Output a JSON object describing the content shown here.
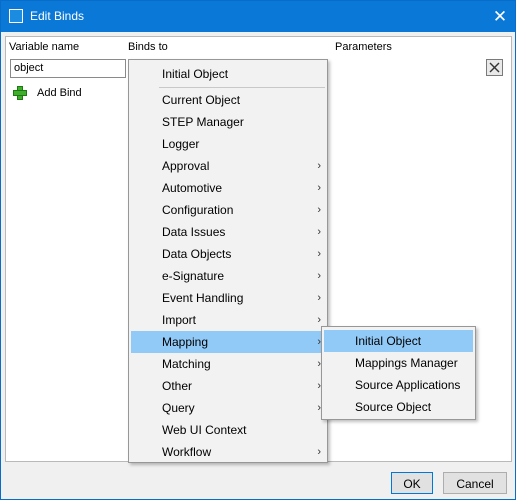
{
  "window": {
    "title": "Edit Binds",
    "close_glyph": "✕",
    "app_icon": "window-icon"
  },
  "columns": {
    "variable": "Variable name",
    "binds": "Binds to",
    "parameters": "Parameters"
  },
  "variable_input": {
    "value": "object"
  },
  "add_bind": {
    "label": "Add Bind",
    "icon": "plus-icon"
  },
  "delete_button": {
    "icon": "x-icon"
  },
  "context_menu": {
    "header": "Initial Object",
    "items": [
      {
        "label": "Current Object",
        "submenu": false
      },
      {
        "label": "STEP Manager",
        "submenu": false
      },
      {
        "label": "Logger",
        "submenu": false
      },
      {
        "label": "Approval",
        "submenu": true
      },
      {
        "label": "Automotive",
        "submenu": true
      },
      {
        "label": "Configuration",
        "submenu": true
      },
      {
        "label": "Data Issues",
        "submenu": true
      },
      {
        "label": "Data Objects",
        "submenu": true
      },
      {
        "label": "e-Signature",
        "submenu": true
      },
      {
        "label": "Event Handling",
        "submenu": true
      },
      {
        "label": "Import",
        "submenu": true
      },
      {
        "label": "Mapping",
        "submenu": true,
        "highlighted": true
      },
      {
        "label": "Matching",
        "submenu": true
      },
      {
        "label": "Other",
        "submenu": true
      },
      {
        "label": "Query",
        "submenu": true
      },
      {
        "label": "Web UI Context",
        "submenu": false
      },
      {
        "label": "Workflow",
        "submenu": true
      }
    ],
    "arrow_glyph": "›"
  },
  "submenu": {
    "items": [
      {
        "label": "Initial Object",
        "highlighted": true
      },
      {
        "label": "Mappings Manager"
      },
      {
        "label": "Source Applications"
      },
      {
        "label": "Source Object"
      }
    ]
  },
  "footer": {
    "ok_label": "OK",
    "cancel_label": "Cancel"
  },
  "colors": {
    "titlebar": "#0a78d7",
    "highlight": "#91c9f7"
  }
}
